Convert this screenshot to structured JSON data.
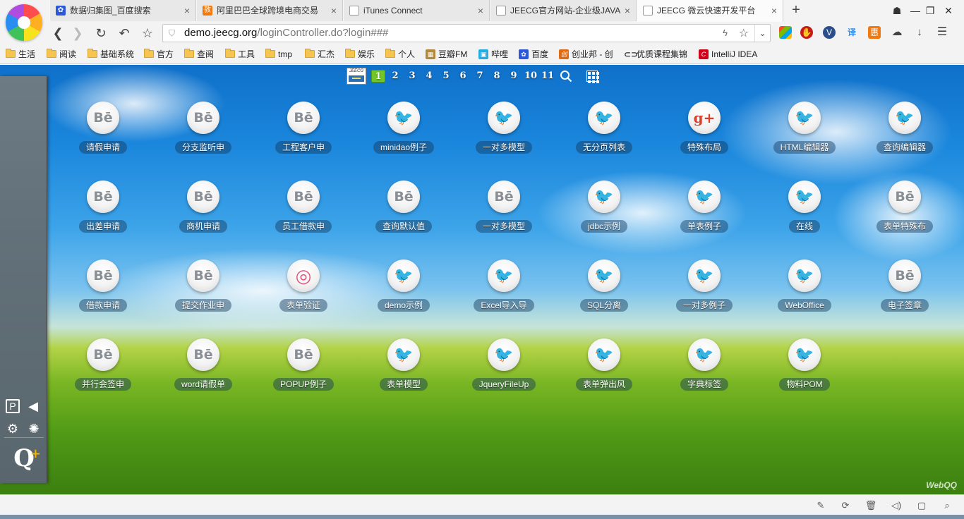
{
  "tabs": [
    {
      "title": "数据归集图_百度搜索",
      "icon": "paw-icon",
      "color": "#2b58d8"
    },
    {
      "title": "阿里巴巴全球跨境电商交易",
      "icon": "alibaba-icon",
      "color": "#f07a10"
    },
    {
      "title": "iTunes Connect",
      "icon": "page-icon",
      "color": "#888888"
    },
    {
      "title": "JEECG官方网站-企业级JAVA",
      "icon": "page-icon",
      "color": "#888888"
    },
    {
      "title": "JEECG 微云快速开发平台",
      "icon": "page-icon",
      "color": "#888888"
    }
  ],
  "address": {
    "host": "demo.jeecg.org",
    "path": "/loginController.do?login###"
  },
  "bookmarks": [
    {
      "label": "生活",
      "type": "folder"
    },
    {
      "label": "阅读",
      "type": "folder"
    },
    {
      "label": "基础系统",
      "type": "folder"
    },
    {
      "label": "官方",
      "type": "folder"
    },
    {
      "label": "查阅",
      "type": "folder"
    },
    {
      "label": "工具",
      "type": "folder"
    },
    {
      "label": "tmp",
      "type": "folder"
    },
    {
      "label": "汇杰",
      "type": "folder"
    },
    {
      "label": "娱乐",
      "type": "folder"
    },
    {
      "label": "个人",
      "type": "folder"
    },
    {
      "label": "豆瓣FM",
      "type": "site",
      "color": "#b38a3a"
    },
    {
      "label": "哔哩",
      "type": "site",
      "color": "#23ade5"
    },
    {
      "label": "百度",
      "type": "site",
      "color": "#2b58d8"
    },
    {
      "label": "创业邦 - 创",
      "type": "site",
      "color": "#e06a10"
    },
    {
      "label": "优质课程集锦",
      "type": "site",
      "color": "#333333"
    },
    {
      "label": "IntelliJ IDEA",
      "type": "site",
      "color": "#d0021b"
    }
  ],
  "pager": {
    "pages": [
      "1",
      "2",
      "3",
      "4",
      "5",
      "6",
      "7",
      "8",
      "9",
      "10",
      "11"
    ],
    "active": "1",
    "logo_text": "JEECG"
  },
  "apps": [
    {
      "label": "请假申请",
      "icon": "be"
    },
    {
      "label": "分支监听申",
      "icon": "be"
    },
    {
      "label": "工程客户申",
      "icon": "be"
    },
    {
      "label": "minidao例子",
      "icon": "tw"
    },
    {
      "label": "一对多模型",
      "icon": "tw"
    },
    {
      "label": "无分页列表",
      "icon": "tw"
    },
    {
      "label": "特殊布局",
      "icon": "gp"
    },
    {
      "label": "HTML编辑器",
      "icon": "tw"
    },
    {
      "label": "查询编辑器",
      "icon": "tw"
    },
    {
      "label": "出差申请",
      "icon": "be"
    },
    {
      "label": "商机申请",
      "icon": "be"
    },
    {
      "label": "员工借款申",
      "icon": "be"
    },
    {
      "label": "查询默认值",
      "icon": "be"
    },
    {
      "label": "一对多模型",
      "icon": "be"
    },
    {
      "label": "jdbc示例",
      "icon": "tw"
    },
    {
      "label": "单表例子",
      "icon": "tw"
    },
    {
      "label": "在线",
      "icon": "tw"
    },
    {
      "label": "表单特殊布",
      "icon": "be"
    },
    {
      "label": "借款申请",
      "icon": "be"
    },
    {
      "label": "提交作业申",
      "icon": "be"
    },
    {
      "label": "表单验证",
      "icon": "dr"
    },
    {
      "label": "demo示例",
      "icon": "tw"
    },
    {
      "label": "Excel导入导",
      "icon": "tw"
    },
    {
      "label": "SQL分离",
      "icon": "tw"
    },
    {
      "label": "一对多例子",
      "icon": "tw"
    },
    {
      "label": "WebOffice",
      "icon": "tw"
    },
    {
      "label": "电子签章",
      "icon": "be"
    },
    {
      "label": "并行会签申",
      "icon": "be"
    },
    {
      "label": "word请假单",
      "icon": "be"
    },
    {
      "label": "POPUP例子",
      "icon": "be"
    },
    {
      "label": "表单模型",
      "icon": "tw"
    },
    {
      "label": "JqueryFileUp",
      "icon": "tw"
    },
    {
      "label": "表单弹出风",
      "icon": "tw"
    },
    {
      "label": "字典标签",
      "icon": "tw"
    },
    {
      "label": "物料POM",
      "icon": "tw"
    }
  ],
  "watermark": "WebQQ"
}
